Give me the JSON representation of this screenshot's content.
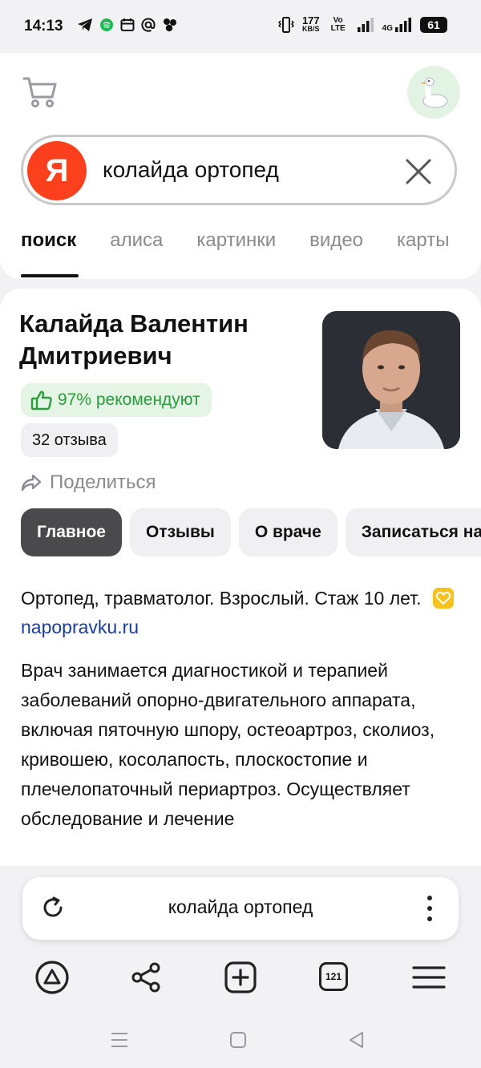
{
  "status_bar": {
    "time": "14:13",
    "speed_value": "177",
    "speed_unit": "KB/S",
    "volte_label": "Vo LTE",
    "network_label": "4G",
    "battery": "61"
  },
  "search": {
    "logo_letter": "Я",
    "query": "колайда ортопед"
  },
  "tabs": [
    {
      "label": "поиск"
    },
    {
      "label": "алиса"
    },
    {
      "label": "картинки"
    },
    {
      "label": "видео"
    },
    {
      "label": "карты"
    }
  ],
  "doctor": {
    "name": "Калайда Валентин Дмитриевич",
    "recommend": "97% рекомендуют",
    "reviews": "32 отзыва",
    "share": "Поделиться"
  },
  "section_tabs": [
    {
      "label": "Главное"
    },
    {
      "label": "Отзывы"
    },
    {
      "label": "О враче"
    },
    {
      "label": "Записаться на"
    }
  ],
  "specialty": {
    "text": "Ортопед, травматолог. Взрослый. Стаж 10 лет.",
    "source_link": "napopravku.ru"
  },
  "description": "Врач занимается диагностикой и терапией заболеваний опорно-двигательного аппарата, включая пяточную шпору, остеоартроз, сколиоз, кривошею, косолапость, плоскостопие и плечелопаточный периартроз. Осуществляет обследование и лечение",
  "address_bar": {
    "text": "колайда ортопед"
  },
  "toolbar": {
    "tabs_count": "121"
  },
  "colors": {
    "yandex_red": "#fc3f1d",
    "recommend_green": "#2a9c3a",
    "link_blue": "#1a3c9c"
  }
}
